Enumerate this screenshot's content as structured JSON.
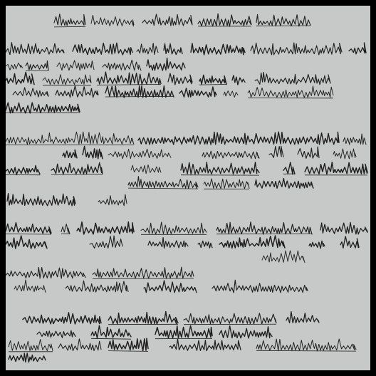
{
  "document": {
    "kind": "illegible handwritten page",
    "legible_text": [],
    "colors": {
      "frame": "#000000",
      "paper": "#c6c9c8",
      "ink": "#1f1f1f"
    }
  }
}
